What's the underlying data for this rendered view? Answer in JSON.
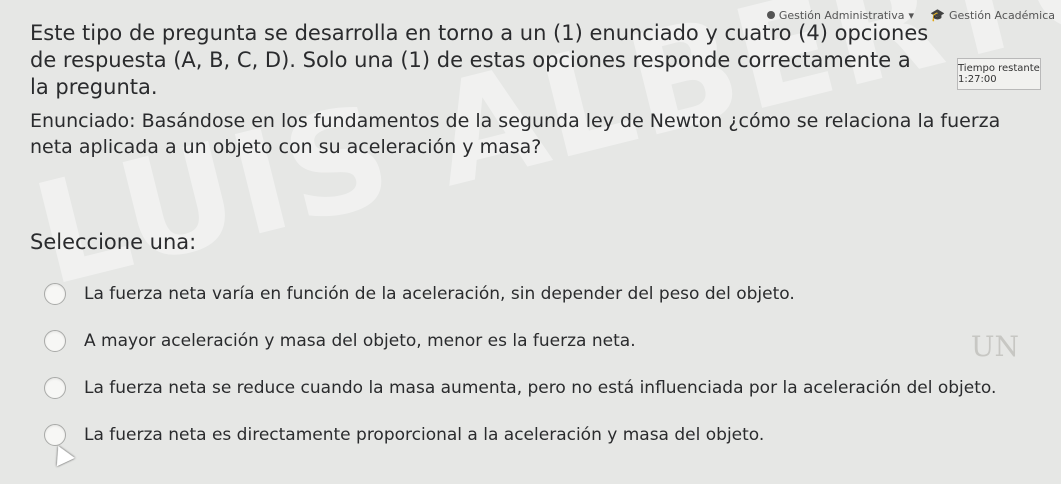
{
  "topbar": {
    "admin_label": "Gestión Administrativa",
    "academic_label": "Gestión Académica"
  },
  "timer": {
    "label": "Tiempo restante 1:27:00"
  },
  "watermark": {
    "text": "LUIS ALBERTO MARTINEZ SANTANA"
  },
  "question": {
    "intro": "Este tipo de pregunta se desarrolla en torno a un (1) enunciado y cuatro (4) opciones de respuesta (A, B, C, D). Solo una (1) de estas opciones responde correctamente a la pregunta.",
    "statement": "Enunciado: Basándose en los fundamentos de la segunda ley de Newton ¿cómo se relaciona la fuerza neta aplicada a un objeto con su aceleración y masa?",
    "select_label": "Seleccione una:",
    "options": [
      "La fuerza neta varía en función de la aceleración, sin depender del peso del objeto.",
      "A mayor aceleración y masa del objeto, menor es la fuerza neta.",
      "La fuerza neta se reduce cuando la masa aumenta, pero no está influenciada por la aceleración del objeto.",
      "La fuerza neta es directamente proporcional a la aceleración y masa del objeto."
    ]
  },
  "logo": {
    "text": "UN"
  }
}
